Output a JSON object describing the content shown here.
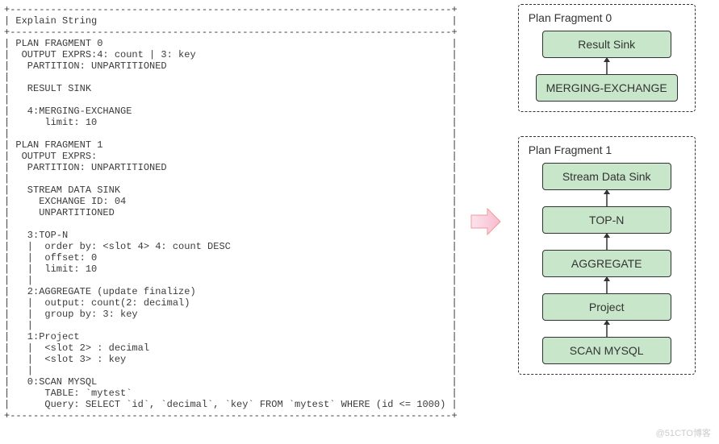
{
  "explain_text": "+----------------------------------------------------------------------------+\n| Explain String                                                             |\n+----------------------------------------------------------------------------+\n| PLAN FRAGMENT 0                                                            |\n|  OUTPUT EXPRS:4: count | 3: key                                            |\n|   PARTITION: UNPARTITIONED                                                 |\n|                                                                            |\n|   RESULT SINK                                                              |\n|                                                                            |\n|   4:MERGING-EXCHANGE                                                       |\n|      limit: 10                                                             |\n|                                                                            |\n| PLAN FRAGMENT 1                                                            |\n|  OUTPUT EXPRS:                                                             |\n|   PARTITION: UNPARTITIONED                                                 |\n|                                                                            |\n|   STREAM DATA SINK                                                         |\n|     EXCHANGE ID: 04                                                        |\n|     UNPARTITIONED                                                          |\n|                                                                            |\n|   3:TOP-N                                                                  |\n|   |  order by: <slot 4> 4: count DESC                                      |\n|   |  offset: 0                                                             |\n|   |  limit: 10                                                             |\n|   |                                                                        |\n|   2:AGGREGATE (update finalize)                                            |\n|   |  output: count(2: decimal)                                             |\n|   |  group by: 3: key                                                      |\n|   |                                                                        |\n|   1:Project                                                                |\n|   |  <slot 2> : decimal                                                    |\n|   |  <slot 3> : key                                                        |\n|   |                                                                        |\n|   0:SCAN MYSQL                                                             |\n|      TABLE: `mytest`                                                       |\n|      Query: SELECT `id`, `decimal`, `key` FROM `mytest` WHERE (id <= 1000) |\n+----------------------------------------------------------------------------+",
  "fragments": [
    {
      "title": "Plan Fragment 0",
      "nodes": [
        "Result Sink",
        "MERGING-EXCHANGE"
      ]
    },
    {
      "title": "Plan Fragment 1",
      "nodes": [
        "Stream Data Sink",
        "TOP-N",
        "AGGREGATE",
        "Project",
        "SCAN  MYSQL"
      ]
    }
  ],
  "arrow_color": "#F8BBD0",
  "arrow_stroke": "#E57373",
  "watermark": "@51CTO博客"
}
